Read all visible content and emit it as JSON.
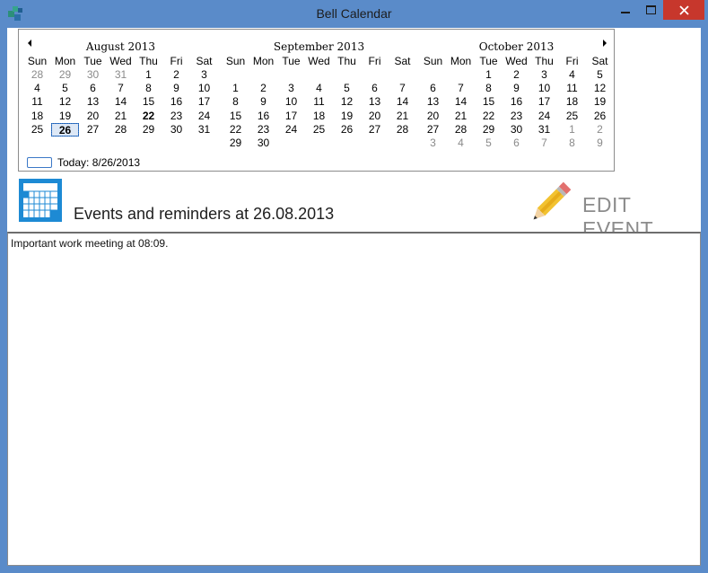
{
  "window": {
    "title": "Bell Calendar",
    "accent_color": "#5a8bc9",
    "close_color": "#c7372c"
  },
  "calendar": {
    "months": [
      {
        "title": "August 2013",
        "weeks": [
          [
            {
              "d": "28",
              "g": true
            },
            {
              "d": "29",
              "g": true
            },
            {
              "d": "30",
              "g": true
            },
            {
              "d": "31",
              "g": true
            },
            {
              "d": "1"
            },
            {
              "d": "2"
            },
            {
              "d": "3"
            }
          ],
          [
            {
              "d": "4"
            },
            {
              "d": "5"
            },
            {
              "d": "6"
            },
            {
              "d": "7"
            },
            {
              "d": "8"
            },
            {
              "d": "9"
            },
            {
              "d": "10"
            }
          ],
          [
            {
              "d": "11"
            },
            {
              "d": "12"
            },
            {
              "d": "13"
            },
            {
              "d": "14"
            },
            {
              "d": "15"
            },
            {
              "d": "16"
            },
            {
              "d": "17"
            }
          ],
          [
            {
              "d": "18"
            },
            {
              "d": "19"
            },
            {
              "d": "20"
            },
            {
              "d": "21"
            },
            {
              "d": "22",
              "b": true
            },
            {
              "d": "23"
            },
            {
              "d": "24"
            }
          ],
          [
            {
              "d": "25"
            },
            {
              "d": "26",
              "t": true
            },
            {
              "d": "27"
            },
            {
              "d": "28"
            },
            {
              "d": "29"
            },
            {
              "d": "30"
            },
            {
              "d": "31"
            }
          ],
          []
        ]
      },
      {
        "title": "September 2013",
        "weeks": [
          [],
          [
            {
              "d": "1"
            },
            {
              "d": "2"
            },
            {
              "d": "3"
            },
            {
              "d": "4"
            },
            {
              "d": "5"
            },
            {
              "d": "6"
            },
            {
              "d": "7"
            }
          ],
          [
            {
              "d": "8"
            },
            {
              "d": "9"
            },
            {
              "d": "10"
            },
            {
              "d": "11"
            },
            {
              "d": "12"
            },
            {
              "d": "13"
            },
            {
              "d": "14"
            }
          ],
          [
            {
              "d": "15"
            },
            {
              "d": "16"
            },
            {
              "d": "17"
            },
            {
              "d": "18"
            },
            {
              "d": "19"
            },
            {
              "d": "20"
            },
            {
              "d": "21"
            }
          ],
          [
            {
              "d": "22"
            },
            {
              "d": "23"
            },
            {
              "d": "24"
            },
            {
              "d": "25"
            },
            {
              "d": "26"
            },
            {
              "d": "27"
            },
            {
              "d": "28"
            }
          ],
          [
            {
              "d": "29"
            },
            {
              "d": "30"
            },
            {
              "d": ""
            },
            {
              "d": ""
            },
            {
              "d": ""
            },
            {
              "d": ""
            },
            {
              "d": ""
            }
          ]
        ]
      },
      {
        "title": "October 2013",
        "weeks": [
          [
            {
              "d": ""
            },
            {
              "d": ""
            },
            {
              "d": "1"
            },
            {
              "d": "2"
            },
            {
              "d": "3"
            },
            {
              "d": "4"
            },
            {
              "d": "5"
            }
          ],
          [
            {
              "d": "6"
            },
            {
              "d": "7"
            },
            {
              "d": "8"
            },
            {
              "d": "9"
            },
            {
              "d": "10"
            },
            {
              "d": "11"
            },
            {
              "d": "12"
            }
          ],
          [
            {
              "d": "13"
            },
            {
              "d": "14"
            },
            {
              "d": "15"
            },
            {
              "d": "16"
            },
            {
              "d": "17"
            },
            {
              "d": "18"
            },
            {
              "d": "19"
            }
          ],
          [
            {
              "d": "20"
            },
            {
              "d": "21"
            },
            {
              "d": "22"
            },
            {
              "d": "23"
            },
            {
              "d": "24"
            },
            {
              "d": "25"
            },
            {
              "d": "26"
            }
          ],
          [
            {
              "d": "27"
            },
            {
              "d": "28"
            },
            {
              "d": "29"
            },
            {
              "d": "30"
            },
            {
              "d": "31"
            },
            {
              "d": "1",
              "g": true
            },
            {
              "d": "2",
              "g": true
            }
          ],
          [
            {
              "d": "3",
              "g": true
            },
            {
              "d": "4",
              "g": true
            },
            {
              "d": "5",
              "g": true
            },
            {
              "d": "6",
              "g": true
            },
            {
              "d": "7",
              "g": true
            },
            {
              "d": "8",
              "g": true
            },
            {
              "d": "9",
              "g": true
            }
          ]
        ]
      }
    ],
    "weekdays": [
      "Sun",
      "Mon",
      "Tue",
      "Wed",
      "Thu",
      "Fri",
      "Sat"
    ],
    "today_label": "Today: 8/26/2013"
  },
  "events": {
    "heading": "Events and reminders at 26.08.2013",
    "edit_label": "EDIT EVENT",
    "text": "Important work meeting at 08:09."
  },
  "icons": {
    "app": "app-icon",
    "calendar": "calendar-icon",
    "pencil": "pencil-icon"
  }
}
